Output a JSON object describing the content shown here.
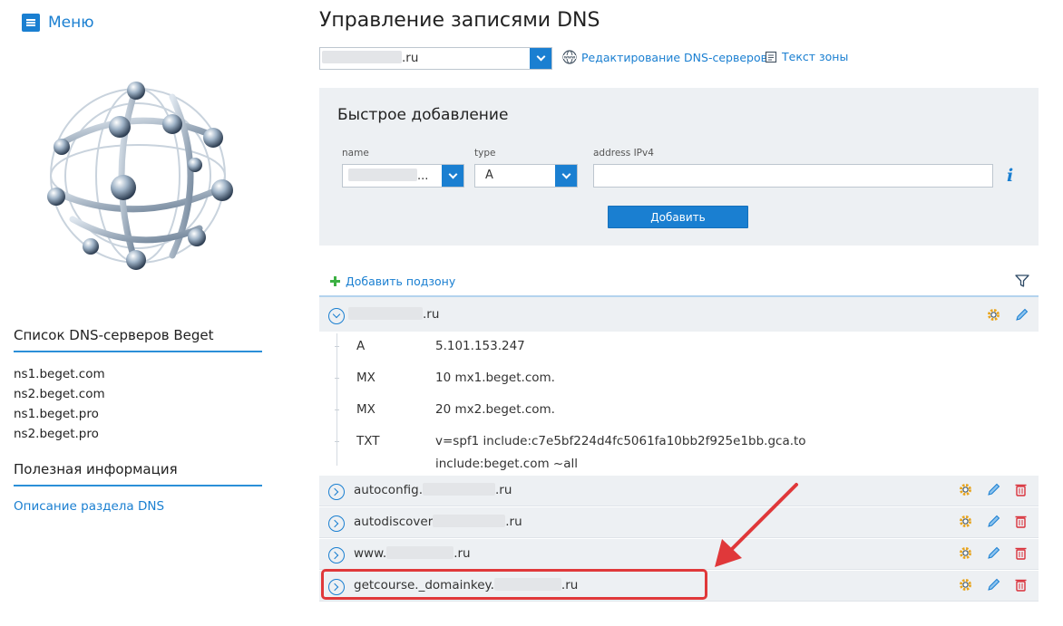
{
  "menu": {
    "label": "Меню"
  },
  "sidebar": {
    "dns_title": "Список DNS-серверов Beget",
    "dns_servers": [
      "ns1.beget.com",
      "ns2.beget.com",
      "ns1.beget.pro",
      "ns2.beget.pro"
    ],
    "info_title": "Полезная информация",
    "info_link": "Описание раздела DNS"
  },
  "header": {
    "title": "Управление записями DNS",
    "domain_suffix": ".ru",
    "edit_dns_link": "Редактирование DNS-серверов",
    "zone_text_link": "Текст зоны"
  },
  "quick_add": {
    "title": "Быстрое добавление",
    "name_label": "name",
    "name_value_suffix": "...",
    "type_label": "type",
    "type_value": "A",
    "address_label": "address IPv4",
    "address_value": "",
    "add_button": "Добавить"
  },
  "records_area": {
    "add_subzone": "Добавить подзону",
    "zone": {
      "name_suffix": ".ru",
      "records": [
        {
          "type": "A",
          "value": "5.101.153.247"
        },
        {
          "type": "MX",
          "value": "10 mx1.beget.com."
        },
        {
          "type": "MX",
          "value": "20 mx2.beget.com."
        },
        {
          "type": "TXT",
          "value": "v=spf1 include:c7e5bf224d4fc5061fa10bb2f925e1bb.gca.to",
          "value2": "include:beget.com ~all"
        }
      ]
    },
    "subzones": [
      {
        "prefix": "autoconfig.",
        "suffix": ".ru"
      },
      {
        "prefix": "autodiscover",
        "suffix": ".ru"
      },
      {
        "prefix": "www.",
        "suffix": ".ru"
      },
      {
        "prefix": "getcourse._domainkey.",
        "suffix": ".ru"
      }
    ]
  },
  "colors": {
    "accent": "#1a7fd1",
    "panel": "#edf0f3",
    "highlight": "#e0383a",
    "delete": "#d9313b",
    "settings": "#e8a41c"
  }
}
